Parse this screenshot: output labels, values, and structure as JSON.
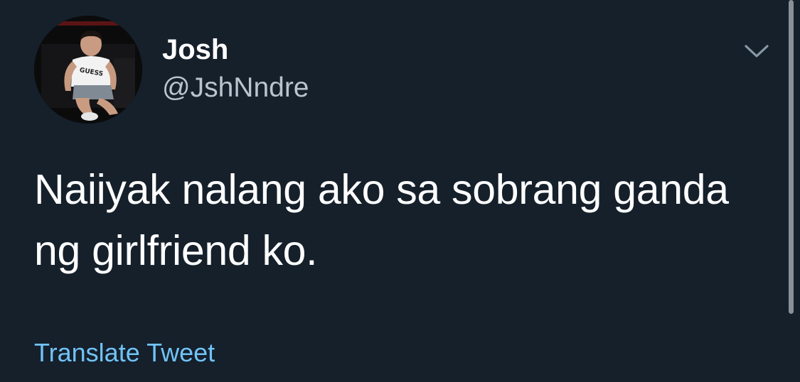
{
  "author": {
    "display_name": "Josh",
    "handle": "@JshNndre",
    "avatar_shirt_text": "GUESS"
  },
  "tweet": {
    "text_lines": [
      "Naiiyak nalang ako sa sobrang ganda",
      "ng girlfriend ko."
    ],
    "translate_label": "Translate Tweet"
  },
  "icons": {
    "more_menu": "chevron-down-icon"
  },
  "colors": {
    "background": "#15202b",
    "text": "#ffffff",
    "handle": "#b9c4ce",
    "link": "#71c3f7"
  }
}
